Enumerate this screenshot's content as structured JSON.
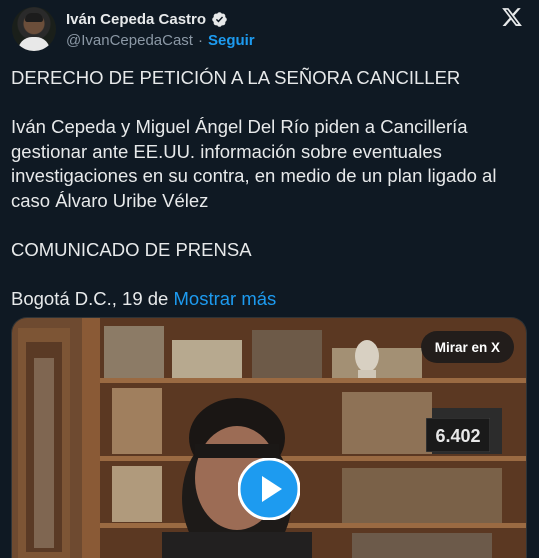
{
  "author": {
    "name": "Iván Cepeda Castro",
    "handle": "@IvanCepedaCast",
    "separator": "·",
    "follow_label": "Seguir"
  },
  "tweet": {
    "lines": [
      "DERECHO DE PETICIÓN A LA SEÑORA CANCILLER",
      "Iván Cepeda y Miguel Ángel Del Río piden a Cancillería gestionar ante EE.UU. información sobre eventuales investigaciones en su contra, en medio de un plan ligado al caso Álvaro Uribe Vélez",
      "COMUNICADO DE PRENSA"
    ],
    "truncated_text": "Bogotá D.C., 19 de",
    "show_more_label": "Mostrar más"
  },
  "media": {
    "watch_label": "Mirar en X",
    "screen_number": "6.402"
  },
  "colors": {
    "background": "#0f1923",
    "text": "#e7e9ea",
    "secondary": "#8b98a5",
    "accent": "#1d9bf0"
  },
  "icons": {
    "verified": "verified-badge-icon",
    "logo": "x-logo-icon",
    "play": "play-icon"
  }
}
